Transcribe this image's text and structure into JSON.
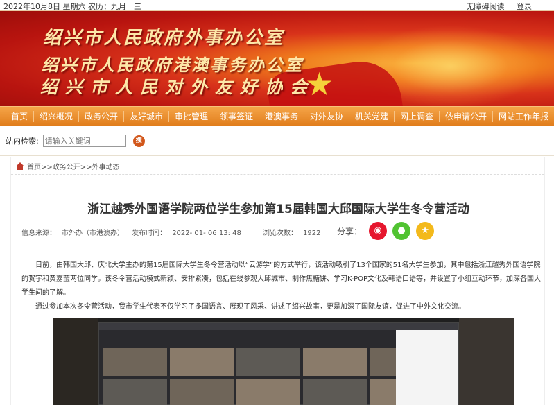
{
  "topbar": {
    "date": "2022年10月8日 星期六 农历：九月十三",
    "accessibility": "无障碍阅读",
    "login": "登录"
  },
  "banner": {
    "line1": "绍兴市人民政府外事办公室",
    "line2": "绍兴市人民政府港澳事务办公室",
    "line3": "绍兴市人民对外友好协会"
  },
  "nav": {
    "items": [
      "首页",
      "绍兴概况",
      "政务公开",
      "友好城市",
      "审批管理",
      "领事签证",
      "港澳事务",
      "对外友协",
      "机关党建",
      "网上调查",
      "依申请公开",
      "网站工作年报"
    ]
  },
  "search": {
    "label": "站内检索:",
    "placeholder": "请输入关键词",
    "button": "搜"
  },
  "breadcrumb": "首页>>政务公开>>外事动态",
  "article": {
    "title": "浙江越秀外国语学院两位学生参加第15届韩国大邱国际大学生冬令营活动",
    "source_label": "信息来源：",
    "source": "市外办（市港澳办）",
    "time_label": "发布时间：",
    "time": "2022- 01- 06 13: 48",
    "views_label": "浏览次数：",
    "views": "1922",
    "share_label": "分享：",
    "para1": "日前，由韩国大邱、庆北大学主办的第15届国际大学生冬令营活动以“云游学”的方式举行，该活动吸引了13个国家的51名大学生参加，其中包括浙江越秀外国语学院的贺宇和黄嘉莹两位同学。该冬令营活动模式新颖、安排紧凑，包括在线参观大邱城市、制作焦糖饼、学习K-POP文化及韩语口语等，并设置了小组互动环节，加深各国大学生间的了解。",
    "para2": "通过参加本次冬令营活动，我市学生代表不仅学习了多国语言、展现了风采、讲述了绍兴故事，更是加深了国际友谊，促进了中外文化交流。"
  },
  "colors": {
    "nav_orange": "#e8891f",
    "weibo": "#e6162d",
    "wechat": "#51c332",
    "qzone": "#f3b91b"
  }
}
